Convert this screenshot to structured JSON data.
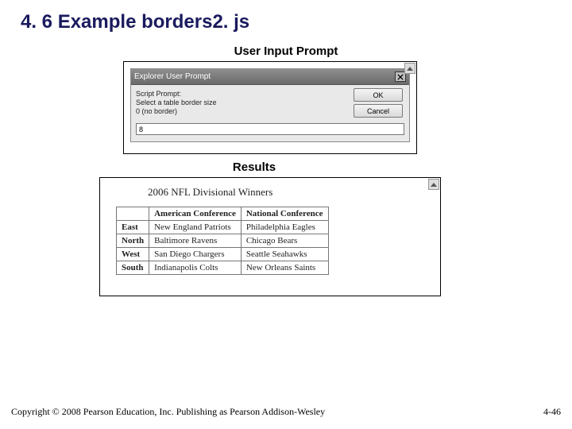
{
  "title": "4. 6 Example borders2. js",
  "section_prompt_label": "User Input Prompt",
  "section_results_label": "Results",
  "dialog": {
    "titlebar": "Explorer User Prompt",
    "line1": "Script Prompt:",
    "line2": "Select a table border size",
    "line3": "0 (no border)",
    "ok_label": "OK",
    "cancel_label": "Cancel",
    "input_value": "8"
  },
  "results": {
    "caption": "2006 NFL Divisional Winners",
    "headers": {
      "blank": "",
      "col1": "American Conference",
      "col2": "National Conference"
    },
    "rows": [
      {
        "h": "East",
        "c1": "New England Patriots",
        "c2": "Philadelphia Eagles"
      },
      {
        "h": "North",
        "c1": "Baltimore Ravens",
        "c2": "Chicago Bears"
      },
      {
        "h": "West",
        "c1": "San Diego Chargers",
        "c2": "Seattle Seahawks"
      },
      {
        "h": "South",
        "c1": "Indianapolis Colts",
        "c2": "New Orleans Saints"
      }
    ]
  },
  "footer": {
    "copyright": "Copyright © 2008 Pearson Education, Inc. Publishing as Pearson Addison-Wesley",
    "pagenum": "4-46"
  }
}
